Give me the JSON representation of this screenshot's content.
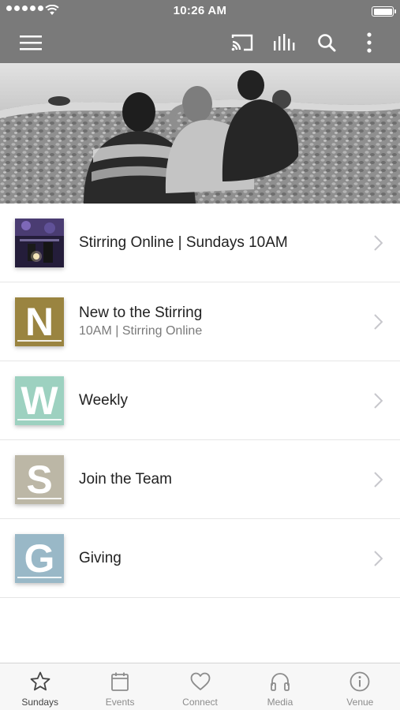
{
  "status_bar": {
    "time": "10:26 AM"
  },
  "nav": {
    "icons": [
      "menu-icon",
      "cast-icon",
      "audio-bars-icon",
      "search-icon",
      "more-vertical-icon"
    ]
  },
  "list": [
    {
      "title": "Stirring Online | Sundays 10AM",
      "subtitle": "",
      "thumb": "photo"
    },
    {
      "title": "New to the Stirring",
      "subtitle": "10AM | Stirring Online",
      "letter": "N",
      "color": "#9a8440"
    },
    {
      "title": "Weekly",
      "subtitle": "",
      "letter": "W",
      "color": "#9dd1c0"
    },
    {
      "title": "Join the Team",
      "subtitle": "",
      "letter": "S",
      "color": "#bcb7a6"
    },
    {
      "title": "Giving",
      "subtitle": "",
      "letter": "G",
      "color": "#99b8c7"
    }
  ],
  "tabs": [
    {
      "label": "Sundays",
      "icon": "star-icon",
      "active": true
    },
    {
      "label": "Events",
      "icon": "calendar-icon",
      "active": false
    },
    {
      "label": "Connect",
      "icon": "heart-icon",
      "active": false
    },
    {
      "label": "Media",
      "icon": "headphones-icon",
      "active": false
    },
    {
      "label": "Venue",
      "icon": "info-icon",
      "active": false
    }
  ],
  "colors": {
    "topbar": "#7a7a7a",
    "tab_active": "#444444",
    "tab_inactive": "#8c8c8c"
  }
}
